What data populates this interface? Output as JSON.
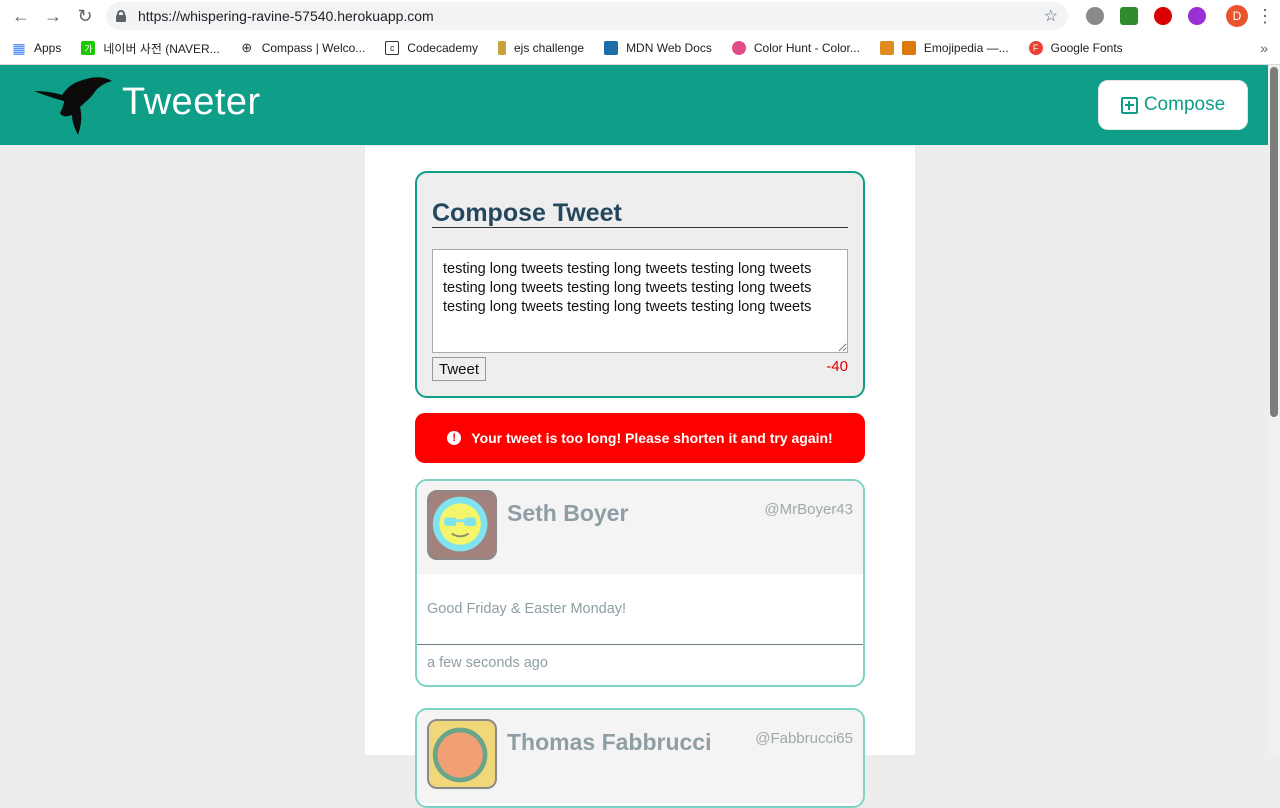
{
  "browser": {
    "url": "https://whispering-ravine-57540.herokuapp.com",
    "profile_initial": "D",
    "bookmarks": [
      {
        "label": "Apps",
        "icon": "apps-grid-icon",
        "color": "#4285f4"
      },
      {
        "label": "네이버 사전 (NAVER...",
        "icon": "naver-dict-icon",
        "color": "#1ec800"
      },
      {
        "label": "Compass | Welco...",
        "icon": "compass-icon",
        "color": "#333333"
      },
      {
        "label": "Codecademy",
        "icon": "codecademy-icon",
        "color": "#333333"
      },
      {
        "label": "ejs challenge",
        "icon": "ejs-icon",
        "color": "#c8a13a"
      },
      {
        "label": "MDN Web Docs",
        "icon": "mdn-icon",
        "color": "#1a6fa6"
      },
      {
        "label": "Color Hunt - Color...",
        "icon": "colorhunt-icon",
        "color": "#e04e8a"
      },
      {
        "label": "Emojipedia —...",
        "icon": "emojipedia-icon",
        "color": "#e08a20"
      },
      {
        "label": "Google Fonts",
        "icon": "google-fonts-icon",
        "color": "#ea4335"
      }
    ]
  },
  "header": {
    "title": "Tweeter",
    "compose_label": "Compose"
  },
  "compose": {
    "title": "Compose Tweet",
    "textarea_value": "testing long tweets testing long tweets testing long tweets testing long tweets testing long tweets testing long tweets testing long tweets testing long tweets testing long tweets",
    "button_label": "Tweet",
    "counter": "-40"
  },
  "error": {
    "message": "Your tweet is too long! Please shorten it and try again!"
  },
  "tweets": [
    {
      "name": "Seth Boyer",
      "handle": "@MrBoyer43",
      "content": "Good Friday & Easter Monday!",
      "time": "a few seconds ago"
    },
    {
      "name": "Thomas Fabbrucci",
      "handle": "@Fabbrucci65",
      "content": "",
      "time": ""
    }
  ],
  "colors": {
    "brand": "#0f9e87",
    "error": "#ff0000",
    "counter": "#e00000"
  }
}
